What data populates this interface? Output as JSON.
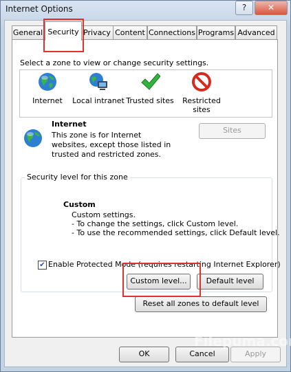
{
  "window": {
    "title": "Internet Options",
    "help_label": "?",
    "close_label": "✕"
  },
  "tabs": [
    {
      "label": "General"
    },
    {
      "label": "Security"
    },
    {
      "label": "Privacy"
    },
    {
      "label": "Content"
    },
    {
      "label": "Connections"
    },
    {
      "label": "Programs"
    },
    {
      "label": "Advanced"
    }
  ],
  "security": {
    "prompt": "Select a zone to view or change security settings.",
    "zones": [
      {
        "label": "Internet",
        "icon": "globe-icon"
      },
      {
        "label": "Local intranet",
        "icon": "intranet-icon"
      },
      {
        "label": "Trusted sites",
        "icon": "checkmark-icon"
      },
      {
        "label": "Restricted sites",
        "icon": "restricted-icon"
      }
    ],
    "zone_name": "Internet",
    "zone_desc": "This zone is for Internet websites, except those listed in trusted and restricted zones.",
    "sites_label": "Sites",
    "level_group_title": "Security level for this zone",
    "level_name": "Custom",
    "level_desc_1": "Custom settings.",
    "level_desc_2": "- To change the settings, click Custom level.",
    "level_desc_3": "- To use the recommended settings, click Default level.",
    "protected_mode_label": "Enable Protected Mode (requires restarting Internet Explorer)",
    "protected_mode_checked": true,
    "custom_level_label": "Custom level...",
    "default_level_label": "Default level",
    "reset_all_label": "Reset all zones to default level"
  },
  "footer": {
    "ok_label": "OK",
    "cancel_label": "Cancel",
    "apply_label": "Apply"
  },
  "watermark": "Filepuma.com",
  "colors": {
    "highlight": "#e0322d",
    "link_blue": "#1a4fa0"
  }
}
